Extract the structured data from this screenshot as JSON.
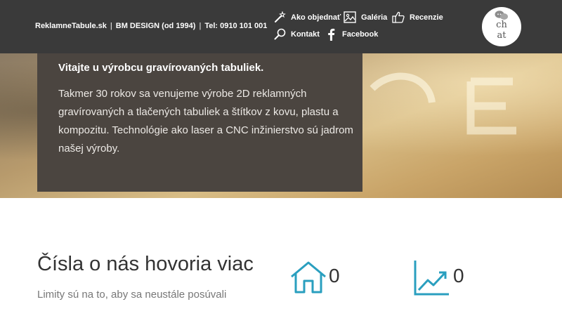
{
  "header": {
    "brand": {
      "site": "ReklamneTabule.sk",
      "company": "BM DESIGN (od 1994)",
      "phone": "Tel: 0910 101 001",
      "separator": "|"
    },
    "nav": [
      {
        "label": "Ako objednať",
        "icon": "magic-wand-icon"
      },
      {
        "label": "Galéria",
        "icon": "image-icon"
      },
      {
        "label": "Recenzie",
        "icon": "thumbs-up-icon"
      },
      {
        "label": "Kontakt",
        "icon": "search-icon"
      },
      {
        "label": "Facebook",
        "icon": "facebook-icon"
      }
    ],
    "chat": {
      "label": "ch at",
      "line1": "ch",
      "line2": "at",
      "icon": "chat-bubbles-icon"
    }
  },
  "hero": {
    "title": "Vitajte u výrobcu gravírovaných tabuliek.",
    "text": "Takmer 30 rokov sa venujeme výrobe 2D reklamných gravírovaných a tlačených tabuliek a štítkov z kovu, plastu a kompozitu. Technológie ako laser a CNC inžinierstvo sú jadrom našej výroby.",
    "scroll_icon": "arrow-down-icon"
  },
  "stats": {
    "title": "Čísla o nás hovoria viac",
    "subtitle": "Limity sú na to, aby sa neustále posúvali",
    "items": [
      {
        "icon": "house-icon",
        "value": "0"
      },
      {
        "icon": "trend-up-chart-icon",
        "value": "0"
      }
    ]
  },
  "colors": {
    "header_bg": "#3a3a3a",
    "hero_box_bg": "#4b4540",
    "accent_teal": "#2a9fbf"
  }
}
